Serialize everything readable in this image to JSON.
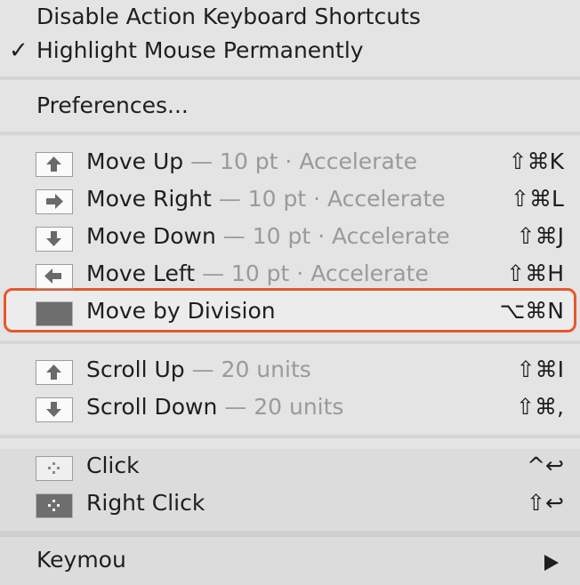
{
  "toggles": [
    {
      "label": "Disable Action Keyboard Shortcuts",
      "checked": false
    },
    {
      "label": "Highlight Mouse Permanently",
      "checked": true,
      "check_glyph": "✓"
    }
  ],
  "preferences_label": "Preferences...",
  "move_items": [
    {
      "label": "Move Up",
      "suffix": " — 10 pt · Accelerate",
      "shortcut": "⇧⌘K",
      "icon": "arrow-up-icon"
    },
    {
      "label": "Move Right",
      "suffix": " — 10 pt · Accelerate",
      "shortcut": "⇧⌘L",
      "icon": "arrow-right-icon"
    },
    {
      "label": "Move Down",
      "suffix": " — 10 pt · Accelerate",
      "shortcut": "⇧⌘J",
      "icon": "arrow-down-icon"
    },
    {
      "label": "Move Left",
      "suffix": " — 10 pt · Accelerate",
      "shortcut": "⇧⌘H",
      "icon": "arrow-left-icon"
    },
    {
      "label": "Move by Division",
      "suffix": "",
      "shortcut": "⌥⌘N",
      "icon": "division-icon",
      "highlighted": true
    }
  ],
  "scroll_items": [
    {
      "label": "Scroll Up",
      "suffix": " — 20 units",
      "shortcut": "⇧⌘I",
      "icon": "arrow-up-icon"
    },
    {
      "label": "Scroll Down",
      "suffix": " — 20 units",
      "shortcut": "⇧⌘,",
      "icon": "arrow-down-icon"
    }
  ],
  "click_items": [
    {
      "label": "Click",
      "shortcut": "^↩",
      "icon": "click-icon"
    },
    {
      "label": "Right Click",
      "shortcut": "⇧↩",
      "icon": "right-click-icon"
    }
  ],
  "submenu": {
    "label": "Keymou",
    "arrow": "submenu-arrow-icon"
  },
  "colors": {
    "highlight_border": "#e8572a",
    "text": "#1e1e1e",
    "dim_text": "#9a9a9a"
  }
}
